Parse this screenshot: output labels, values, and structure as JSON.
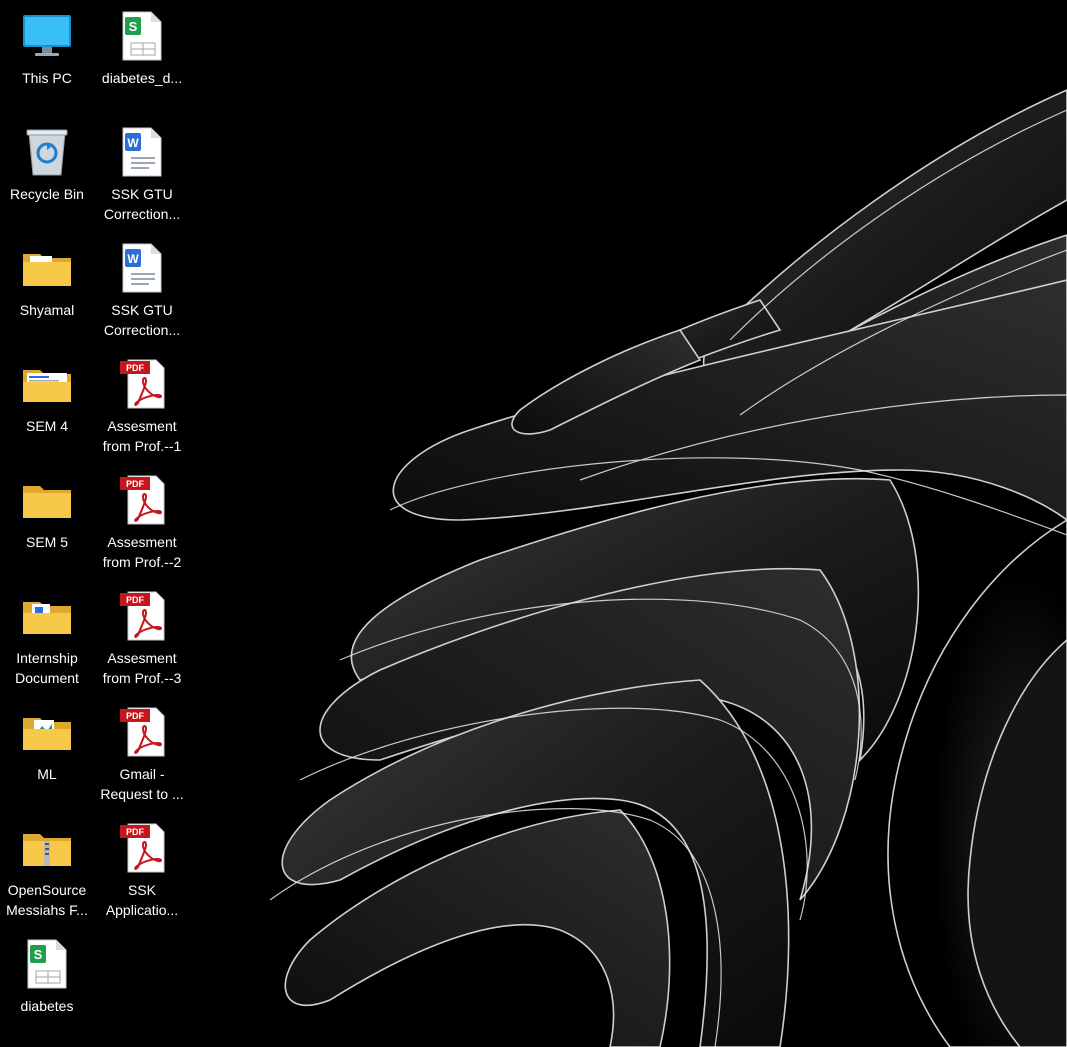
{
  "desktop": {
    "col1": [
      {
        "label": "This PC",
        "icon": "computer-monitor-icon"
      },
      {
        "label": "Recycle Bin",
        "icon": "recycle-bin-icon"
      },
      {
        "label": "Shyamal",
        "icon": "folder-icon"
      },
      {
        "label": "SEM 4",
        "icon": "folder-icon"
      },
      {
        "label": "SEM 5",
        "icon": "folder-icon"
      },
      {
        "label": "Internship Document",
        "icon": "folder-icon"
      },
      {
        "label": "ML",
        "icon": "folder-icon"
      },
      {
        "label": "OpenSource Messiahs F...",
        "icon": "zip-folder-icon"
      },
      {
        "label": "diabetes",
        "icon": "spreadsheet-file-icon"
      }
    ],
    "col2": [
      {
        "label": "diabetes_d...",
        "icon": "spreadsheet-file-icon"
      },
      {
        "label": "SSK GTU Correction...",
        "icon": "word-document-icon"
      },
      {
        "label": "SSK GTU Correction...",
        "icon": "word-document-icon"
      },
      {
        "label": "Assesment from Prof.--1",
        "icon": "pdf-file-icon"
      },
      {
        "label": "Assesment from Prof.--2",
        "icon": "pdf-file-icon"
      },
      {
        "label": "Assesment from Prof.--3",
        "icon": "pdf-file-icon"
      },
      {
        "label": "Gmail - Request to ...",
        "icon": "pdf-file-icon"
      },
      {
        "label": "SSK Applicatio...",
        "icon": "pdf-file-icon"
      }
    ],
    "pdf_badge": "PDF",
    "colors": {
      "folder": "#f7c948",
      "folder_dark": "#e0a82e",
      "pdf_red": "#c4161c",
      "sheet_green": "#1fa04a",
      "word_blue": "#2b6fd6"
    }
  }
}
